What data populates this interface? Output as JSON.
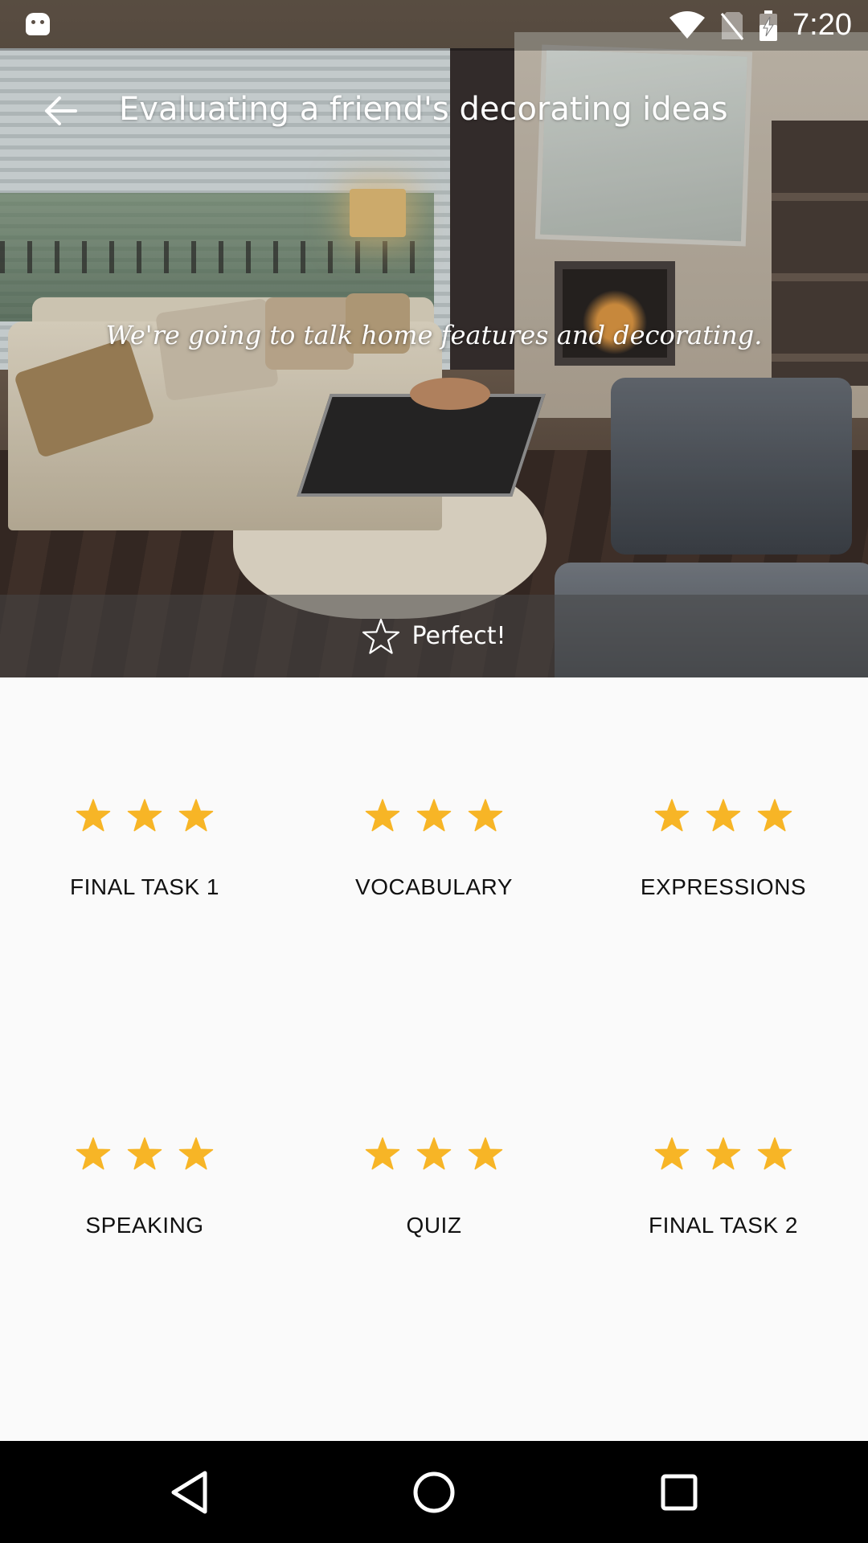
{
  "status_bar": {
    "time": "7:20",
    "icons": [
      "android-notification-icon",
      "wifi-icon",
      "no-sim-icon",
      "battery-charging-icon"
    ]
  },
  "header": {
    "title": "Evaluating a friend's decorating ideas",
    "subtitle": "We're going to talk home features and decorating.",
    "result_label": "Perfect!",
    "result_icon": "star-outline-icon",
    "back_icon": "arrow-left-icon"
  },
  "tasks": [
    {
      "label": "FINAL TASK 1",
      "stars_earned": 3,
      "stars_total": 3
    },
    {
      "label": "VOCABULARY",
      "stars_earned": 3,
      "stars_total": 3
    },
    {
      "label": "EXPRESSIONS",
      "stars_earned": 3,
      "stars_total": 3
    },
    {
      "label": "SPEAKING",
      "stars_earned": 3,
      "stars_total": 3
    },
    {
      "label": "QUIZ",
      "stars_earned": 3,
      "stars_total": 3
    },
    {
      "label": "FINAL TASK 2",
      "stars_earned": 3,
      "stars_total": 3
    }
  ],
  "nav_bar": {
    "icons": [
      "back-triangle-icon",
      "home-circle-icon",
      "recents-square-icon"
    ]
  },
  "colors": {
    "star": "#F7B526",
    "background": "#FAFAFA",
    "label_text": "#111111",
    "nav_bar": "#000000"
  }
}
